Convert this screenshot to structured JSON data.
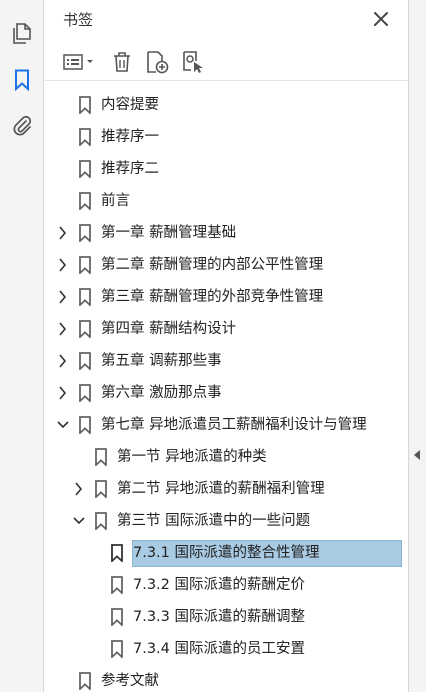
{
  "panel": {
    "title": "书签"
  },
  "rail": {
    "items": [
      {
        "name": "pages",
        "icon": "page-thumbnails-icon"
      },
      {
        "name": "bookmarks",
        "icon": "bookmark-icon",
        "active": true
      },
      {
        "name": "attachments",
        "icon": "paperclip-icon"
      }
    ]
  },
  "toolbar": {
    "items": [
      "options-menu",
      "delete-bookmark",
      "new-bookmark",
      "new-bookmark-from-structure"
    ]
  },
  "bookmarks": [
    {
      "label": "内容提要",
      "level": 0,
      "state": "none"
    },
    {
      "label": "推荐序一",
      "level": 0,
      "state": "none"
    },
    {
      "label": "推荐序二",
      "level": 0,
      "state": "none"
    },
    {
      "label": "前言",
      "level": 0,
      "state": "none"
    },
    {
      "label": "第一章 薪酬管理基础",
      "level": 0,
      "state": "collapsed"
    },
    {
      "label": "第二章 薪酬管理的内部公平性管理",
      "level": 0,
      "state": "collapsed"
    },
    {
      "label": "第三章 薪酬管理的外部竞争性管理",
      "level": 0,
      "state": "collapsed"
    },
    {
      "label": "第四章 薪酬结构设计",
      "level": 0,
      "state": "collapsed"
    },
    {
      "label": "第五章 调薪那些事",
      "level": 0,
      "state": "collapsed"
    },
    {
      "label": "第六章 激励那点事",
      "level": 0,
      "state": "collapsed"
    },
    {
      "label": "第七章 异地派遣员工薪酬福利设计与管理",
      "level": 0,
      "state": "expanded"
    },
    {
      "label": "第一节 异地派遣的种类",
      "level": 1,
      "state": "none"
    },
    {
      "label": "第二节 异地派遣的薪酬福利管理",
      "level": 1,
      "state": "collapsed"
    },
    {
      "label": "第三节 国际派遣中的一些问题",
      "level": 1,
      "state": "expanded"
    },
    {
      "label": "7.3.1 国际派遣的整合性管理",
      "level": 2,
      "state": "none",
      "selected": true
    },
    {
      "label": "7.3.2 国际派遣的薪酬定价",
      "level": 2,
      "state": "none"
    },
    {
      "label": "7.3.3 国际派遣的薪酬调整",
      "level": 2,
      "state": "none"
    },
    {
      "label": "7.3.4 国际派遣的员工安置",
      "level": 2,
      "state": "none"
    },
    {
      "label": "参考文献",
      "level": 0,
      "state": "none"
    }
  ],
  "colors": {
    "selection": "#a8cbe3",
    "accent": "#1a73e8",
    "icon": "#555555"
  }
}
